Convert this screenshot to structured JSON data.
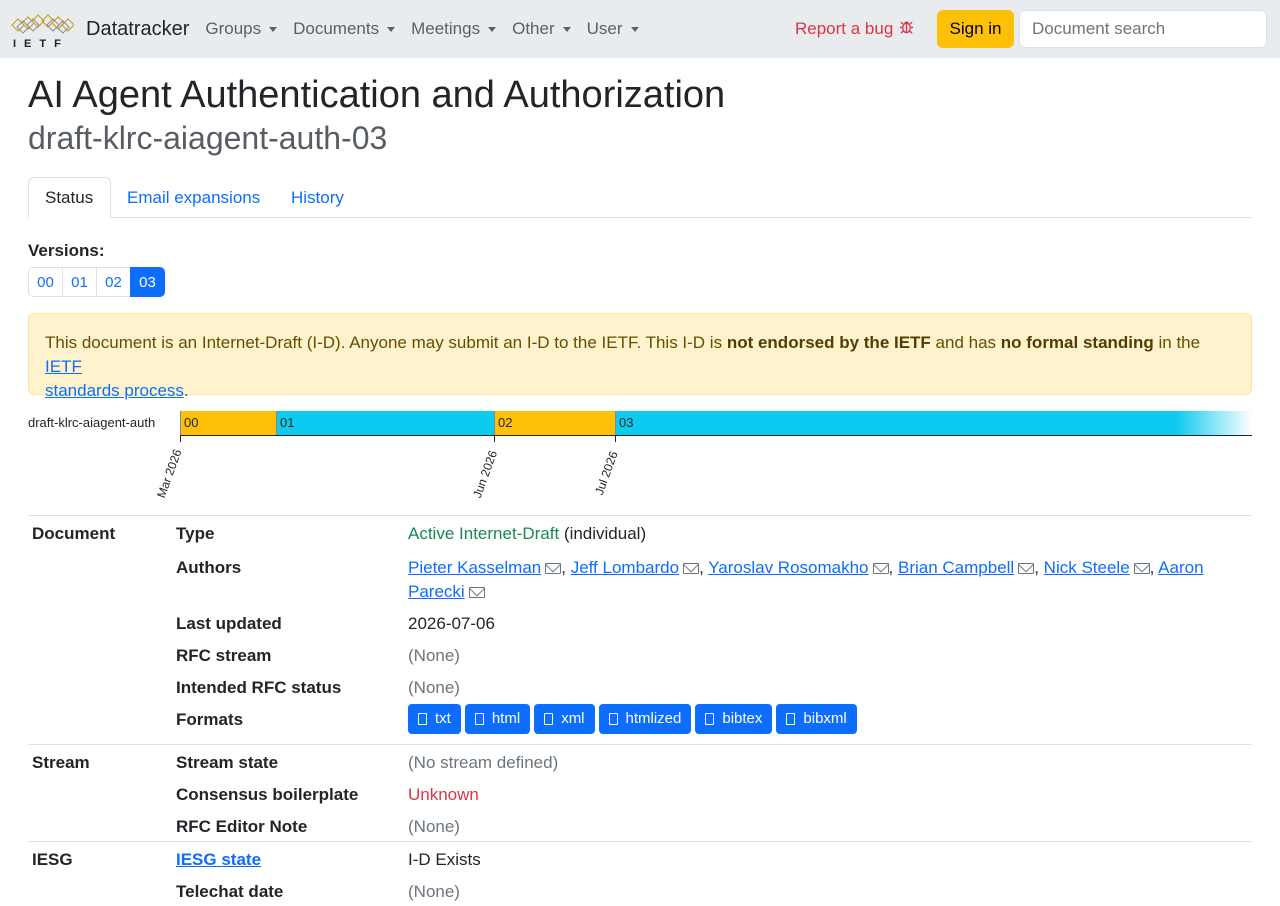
{
  "navbar": {
    "logo_text": "IETF",
    "brand": "Datatracker",
    "menu": [
      "Groups",
      "Documents",
      "Meetings",
      "Other",
      "User"
    ],
    "report_bug": "Report a bug",
    "signin": "Sign in",
    "search_placeholder": "Document search"
  },
  "doc": {
    "title": "AI Agent Authentication and Authorization",
    "name": "draft-klrc-aiagent-auth-03"
  },
  "tabs": [
    "Status",
    "Email expansions",
    "History"
  ],
  "versions": {
    "label": "Versions:",
    "items": [
      "00",
      "01",
      "02",
      "03"
    ],
    "active": "03"
  },
  "alert": {
    "p1": "This document is an Internet-Draft (I-D). Anyone may submit an I-D to the IETF. This I-D is ",
    "b1": "not endorsed by the IETF",
    "p2": " and has ",
    "b2": "no formal standing",
    "p3": " in the ",
    "link1": "IETF",
    "link2": "standards process",
    "end": "."
  },
  "timeline": {
    "name": "draft-klrc-aiagent-auth",
    "segments": [
      {
        "label": "00",
        "color": "#ffc107"
      },
      {
        "label": "01",
        "color": "#0dcaf0"
      },
      {
        "label": "02",
        "color": "#ffc107"
      },
      {
        "label": "03",
        "color": "#0dcaf0"
      }
    ],
    "dates": [
      "Mar 2026",
      "Jun 2026",
      "Jul 2026"
    ]
  },
  "info": {
    "document": {
      "heading": "Document",
      "type_label": "Type",
      "type_value": "Active Internet-Draft",
      "type_suffix": "(individual)",
      "authors_label": "Authors",
      "authors": [
        "Pieter Kasselman",
        "Jeff Lombardo",
        "Yaroslav Rosomakho",
        "Brian Campbell",
        "Nick Steele",
        "Aaron Parecki"
      ],
      "last_updated_label": "Last updated",
      "last_updated": "2026-07-06",
      "rfc_stream_label": "RFC stream",
      "rfc_stream": "(None)",
      "intended_label": "Intended RFC status",
      "intended": "(None)",
      "formats_label": "Formats",
      "formats": [
        "txt",
        "html",
        "xml",
        "htmlized",
        "bibtex",
        "bibxml"
      ]
    },
    "stream": {
      "heading": "Stream",
      "state_label": "Stream state",
      "state": "(No stream defined)",
      "consensus_label": "Consensus boilerplate",
      "consensus": "Unknown",
      "note_label": "RFC Editor Note",
      "note": "(None)"
    },
    "iesg": {
      "heading": "IESG",
      "state_label": "IESG state",
      "state": "I-D Exists",
      "telechat_label": "Telechat date",
      "telechat": "(None)"
    }
  }
}
